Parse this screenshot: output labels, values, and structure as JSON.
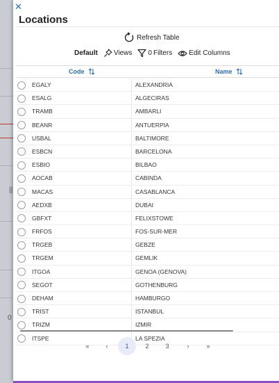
{
  "dialog": {
    "close_glyph": "✕",
    "title": "Locations"
  },
  "toolbar": {
    "refresh_label": "Refresh Table",
    "default_label": "Default",
    "views_label": "Views",
    "filters_count": "0",
    "filters_label": "Filters",
    "edit_columns_label": "Edit Columns"
  },
  "table": {
    "columns": {
      "code": "Code",
      "name": "Name"
    },
    "rows": [
      {
        "code": "EGALY",
        "name": "ALEXANDRIA"
      },
      {
        "code": "ESALG",
        "name": "ALGECIRAS"
      },
      {
        "code": "TRAMB",
        "name": "AMBARLI"
      },
      {
        "code": "BEANR",
        "name": "ANTUERPIA"
      },
      {
        "code": "USBAL",
        "name": "BALTIMORE"
      },
      {
        "code": "ESBCN",
        "name": "BARCELONA"
      },
      {
        "code": "ESBIO",
        "name": "BILBAO"
      },
      {
        "code": "AOCAB",
        "name": "CABINDA"
      },
      {
        "code": "MACAS",
        "name": "CASABLANCA"
      },
      {
        "code": "AEDXB",
        "name": "DUBAI"
      },
      {
        "code": "GBFXT",
        "name": "FELIXSTOWE"
      },
      {
        "code": "FRFOS",
        "name": "FOS-SUR-MER"
      },
      {
        "code": "TRGEB",
        "name": "GEBZE"
      },
      {
        "code": "TRGEM",
        "name": "GEMLIK"
      },
      {
        "code": "ITGOA",
        "name": "GENOA (GENOVA)"
      },
      {
        "code": "SEGOT",
        "name": "GOTHENBURG"
      },
      {
        "code": "DEHAM",
        "name": "HAMBURGO"
      },
      {
        "code": "TRIST",
        "name": "ISTANBUL"
      },
      {
        "code": "TRIZM",
        "name": "IZMIR"
      },
      {
        "code": "ITSPE",
        "name": "LA SPEZIA"
      }
    ]
  },
  "pagination": {
    "first": "«",
    "prev": "‹",
    "pages": [
      "1",
      "2",
      "3"
    ],
    "current": "1",
    "next": "›",
    "last": "»"
  },
  "background": {
    "left_glyph_1": "|||",
    "left_glyph_2": "0"
  },
  "colors": {
    "accent": "#2f6fb3",
    "bottom_bar": "#8a4fbf"
  }
}
